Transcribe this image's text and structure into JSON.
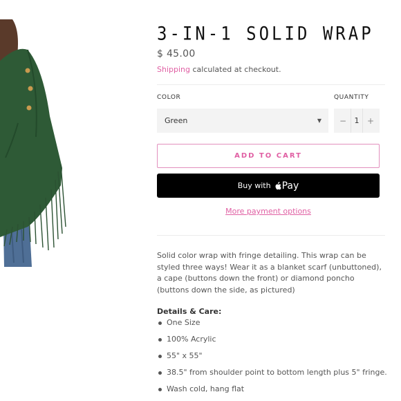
{
  "product": {
    "title": "3-IN-1 SOLID WRAP",
    "price": "$ 45.00",
    "shipping_link": "Shipping",
    "shipping_text": " calculated at checkout."
  },
  "color": {
    "label": "COLOR",
    "selected": "Green"
  },
  "quantity": {
    "label": "QUANTITY",
    "minus": "−",
    "value": "1",
    "plus": "+"
  },
  "buttons": {
    "add_to_cart": "ADD TO CART",
    "buy_with": "Buy with",
    "pay": "Pay",
    "more_payment": "More payment options"
  },
  "description": {
    "text": "Solid color wrap with fringe detailing. This wrap can be styled three ways! Wear it as a blanket scarf (unbuttoned), a cape (buttons down the front) or diamond poncho (buttons down the side, as pictured)",
    "details_heading": "Details & Care:",
    "details": [
      "One Size",
      "100% Acrylic",
      "55\" x 55\"",
      "38.5\" from shoulder point to bottom length plus 5\" fringe.",
      "Wash cold, hang flat"
    ]
  },
  "colors": {
    "accent": "#e05fa3",
    "wrap_green": "#2e5a36",
    "button_dark": "#000000"
  },
  "icons": {
    "caret": "chevron-down-icon",
    "apple": "apple-logo-icon"
  }
}
